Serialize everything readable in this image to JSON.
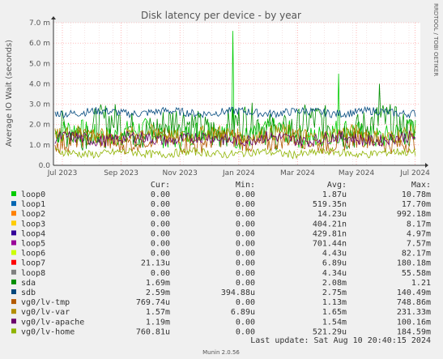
{
  "chart_data": {
    "type": "line",
    "title": "Disk latency per device - by year",
    "ylabel": "Average IO Wait (seconds)",
    "side_label": "RRDTOOL / TOBI OETIKER",
    "ylim": [
      0,
      0.007
    ],
    "y_ticks": [
      {
        "v": 0.0,
        "label": "0.0"
      },
      {
        "v": 0.001,
        "label": "1.0 m"
      },
      {
        "v": 0.002,
        "label": "2.0 m"
      },
      {
        "v": 0.003,
        "label": "3.0 m"
      },
      {
        "v": 0.004,
        "label": "4.0 m"
      },
      {
        "v": 0.005,
        "label": "5.0 m"
      },
      {
        "v": 0.006,
        "label": "6.0 m"
      },
      {
        "v": 0.007,
        "label": "7.0 m"
      }
    ],
    "x_ticks": [
      "Jul 2023",
      "Sep 2023",
      "Nov 2023",
      "Jan 2024",
      "Mar 2024",
      "May 2024",
      "Jul 2024"
    ],
    "grid": true,
    "columns": [
      "Cur:",
      "Min:",
      "Avg:",
      "Max:"
    ],
    "series": [
      {
        "name": "loop0",
        "color": "#00cc00",
        "base": 0.00155,
        "amp": 0.0006,
        "cur": "0.00",
        "min": "0.00",
        "avg": "1.87u",
        "max": "10.78m"
      },
      {
        "name": "loop1",
        "color": "#0066b3",
        "base": 0.0,
        "amp": 0.0,
        "cur": "0.00",
        "min": "0.00",
        "avg": "519.35n",
        "max": "17.70m"
      },
      {
        "name": "loop2",
        "color": "#ff8000",
        "base": 0.0,
        "amp": 0.0,
        "cur": "0.00",
        "min": "0.00",
        "avg": "14.23u",
        "max": "992.18m"
      },
      {
        "name": "loop3",
        "color": "#ffcc00",
        "base": 0.0,
        "amp": 0.0,
        "cur": "0.00",
        "min": "0.00",
        "avg": "404.21n",
        "max": "8.17m"
      },
      {
        "name": "loop4",
        "color": "#330099",
        "base": 0.0,
        "amp": 0.0,
        "cur": "0.00",
        "min": "0.00",
        "avg": "429.81n",
        "max": "4.97m"
      },
      {
        "name": "loop5",
        "color": "#990099",
        "base": 0.0,
        "amp": 0.0,
        "cur": "0.00",
        "min": "0.00",
        "avg": "701.44n",
        "max": "7.57m"
      },
      {
        "name": "loop6",
        "color": "#ccff00",
        "base": 0.0,
        "amp": 0.0,
        "cur": "0.00",
        "min": "0.00",
        "avg": "4.43u",
        "max": "82.17m"
      },
      {
        "name": "loop7",
        "color": "#ff0000",
        "base": 0.0,
        "amp": 0.0,
        "cur": "21.13u",
        "min": "0.00",
        "avg": "6.89u",
        "max": "180.18m"
      },
      {
        "name": "loop8",
        "color": "#808080",
        "base": 0.0,
        "amp": 0.0,
        "cur": "0.00",
        "min": "0.00",
        "avg": "4.34u",
        "max": "55.58m"
      },
      {
        "name": "sda",
        "color": "#008f00",
        "base": 0.0019,
        "amp": 0.0009,
        "cur": "1.69m",
        "min": "0.00",
        "avg": "2.08m",
        "max": "1.21"
      },
      {
        "name": "sdb",
        "color": "#00487d",
        "base": 0.0026,
        "amp": 0.0002,
        "cur": "2.59m",
        "min": "394.88u",
        "avg": "2.75m",
        "max": "140.49m"
      },
      {
        "name": "vg0/lv-tmp",
        "color": "#b35a00",
        "base": 0.0012,
        "amp": 0.0005,
        "cur": "769.74u",
        "min": "0.00",
        "avg": "1.13m",
        "max": "748.86m"
      },
      {
        "name": "vg0/lv-var",
        "color": "#b38f00",
        "base": 0.0015,
        "amp": 0.0004,
        "cur": "1.57m",
        "min": "6.89u",
        "avg": "1.65m",
        "max": "231.33m"
      },
      {
        "name": "vg0/lv-apache",
        "color": "#6b006b",
        "base": 0.0013,
        "amp": 0.0003,
        "cur": "1.19m",
        "min": "0.00",
        "avg": "1.54m",
        "max": "100.16m"
      },
      {
        "name": "vg0/lv-home",
        "color": "#8fb300",
        "base": 0.0006,
        "amp": 0.0002,
        "cur": "760.81u",
        "min": "0.00",
        "avg": "521.29u",
        "max": "184.59m"
      }
    ],
    "last_update": "Last update: Sat Aug 10 20:40:15 2024",
    "footer": "Munin 2.0.56"
  }
}
